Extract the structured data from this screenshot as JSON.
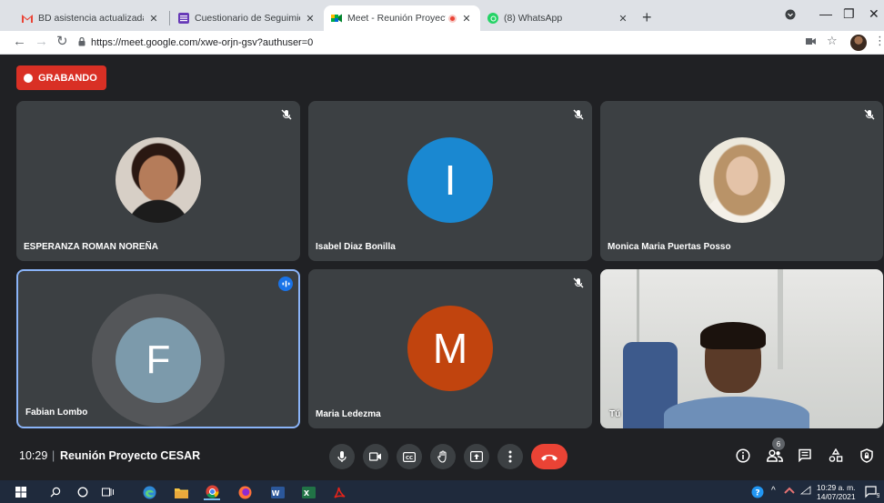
{
  "browser": {
    "tabs": [
      {
        "title": "BD asistencia actualizada diplom",
        "favicon": "gmail-icon",
        "color": "#ea4335"
      },
      {
        "title": "Cuestionario de Seguimiento a G",
        "favicon": "forms-icon",
        "color": "#673ab7"
      },
      {
        "title": "Meet - Reunión Proyecto CE",
        "favicon": "meet-icon",
        "color": "#00ac47",
        "active": true
      },
      {
        "title": "(8) WhatsApp",
        "favicon": "whatsapp-icon",
        "color": "#25d366"
      }
    ],
    "new_tab": "+",
    "url": "https://meet.google.com/xwe-orjn-gsv?authuser=0"
  },
  "meet": {
    "recording_label": "GRABANDO",
    "participants": [
      {
        "name": "ESPERANZA ROMAN NOREÑA",
        "type": "photo",
        "muted": true
      },
      {
        "name": "Isabel Diaz Bonilla",
        "type": "initial",
        "initial": "I",
        "color": "#1a88d1",
        "muted": true
      },
      {
        "name": "Monica Maria Puertas Posso",
        "type": "photo",
        "muted": true
      },
      {
        "name": "Fabian Lombo",
        "type": "initial",
        "initial": "F",
        "color": "#7c9aab",
        "speaking": true
      },
      {
        "name": "Maria Ledezma",
        "type": "initial",
        "initial": "M",
        "color": "#c1440e",
        "muted": true
      },
      {
        "name": "Tú",
        "type": "video",
        "muted": false
      }
    ],
    "time": "10:29",
    "separator": "|",
    "meeting_title": "Reunión Proyecto CESAR",
    "people_count": "6",
    "accent_red": "#d93025",
    "hangup_color": "#ea4335"
  },
  "taskbar": {
    "time": "10:29 a. m.",
    "date": "14/07/2021",
    "notifications": "9"
  }
}
